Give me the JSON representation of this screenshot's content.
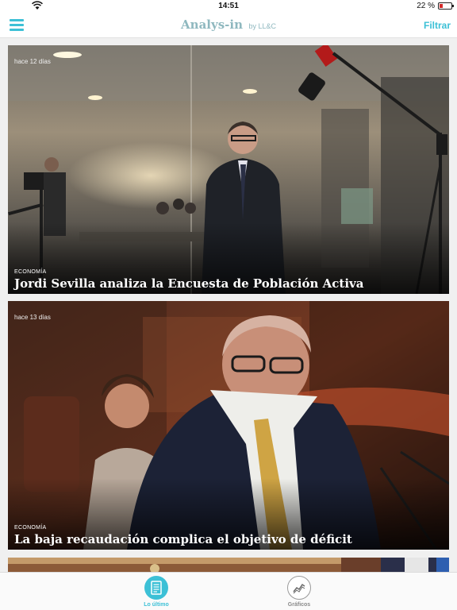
{
  "status_bar": {
    "time": "14:51",
    "battery_percent": "22 %",
    "battery_level": 0.22,
    "wifi_icon": "wifi-icon"
  },
  "nav_bar": {
    "menu_icon": "hamburger-menu-icon",
    "brand": "Analys-in",
    "by_label": "by LL&C",
    "filter_label": "Filtrar",
    "accent_color": "#3cc0d6"
  },
  "articles": [
    {
      "age": "hace 12 días",
      "category": "ECONOMÍA",
      "headline": "Jordi Sevilla analiza la Encuesta de Población Activa"
    },
    {
      "age": "hace 13 días",
      "category": "ECONOMÍA",
      "headline": "La baja recaudación complica el objetivo de déficit"
    }
  ],
  "tab_bar": {
    "tabs": [
      {
        "label": "Lo último",
        "icon": "news-document-icon",
        "active": true
      },
      {
        "label": "Gráficos",
        "icon": "line-chart-icon",
        "active": false
      }
    ]
  }
}
